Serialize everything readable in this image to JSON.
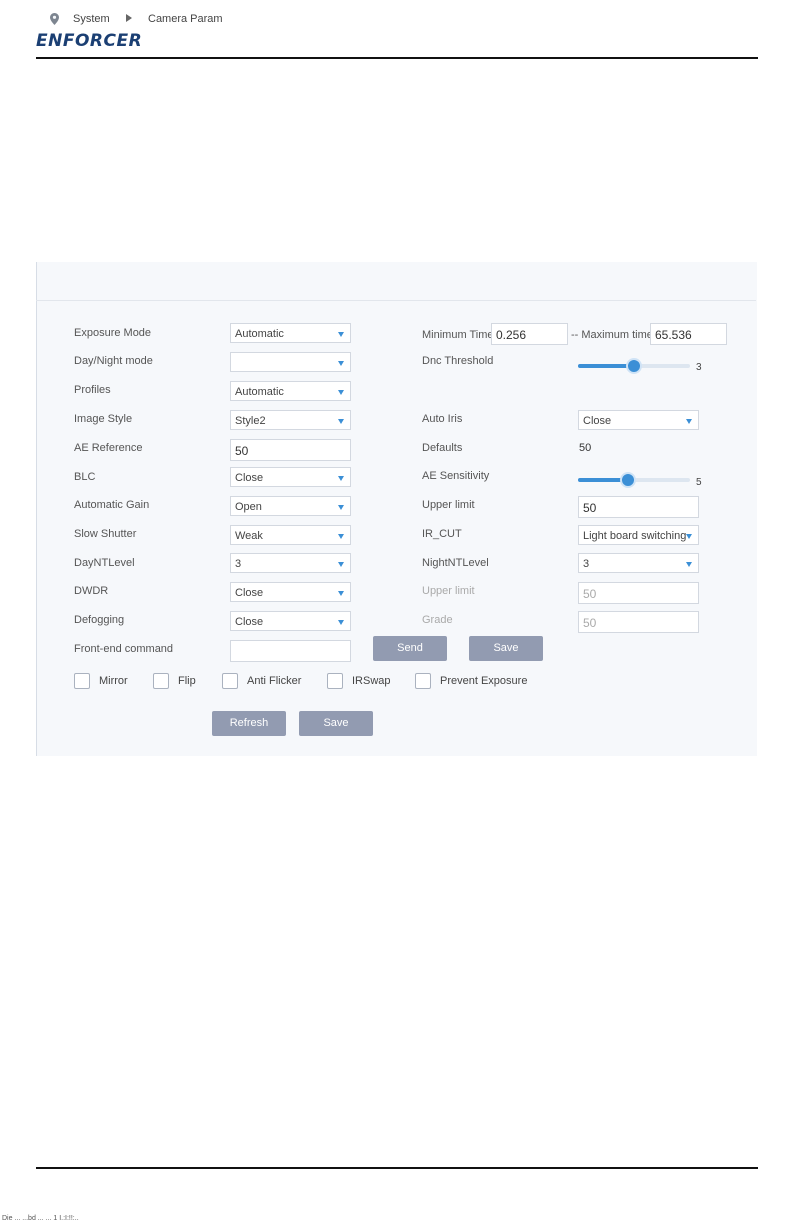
{
  "header": {
    "logo": "ENFORCER"
  },
  "footer": {
    "text": "Die ... ...bd ... ... 1 I.:I:!!:.."
  },
  "breadcrumb": {
    "items": [
      "System",
      "Camera Param"
    ]
  },
  "form": {
    "exposure_mode": {
      "label": "Exposure Mode",
      "value": "Automatic"
    },
    "day_night_mode": {
      "label": "Day/Night mode",
      "value": ""
    },
    "profiles": {
      "label": "Profiles",
      "value": "Automatic"
    },
    "image_style": {
      "label": "Image Style",
      "value": "Style2"
    },
    "ae_reference": {
      "label": "AE Reference",
      "value": "50"
    },
    "blc": {
      "label": "BLC",
      "value": "Close"
    },
    "automatic_gain": {
      "label": "Automatic Gain",
      "value": "Open"
    },
    "slow_shutter": {
      "label": "Slow Shutter",
      "value": "Weak"
    },
    "day_nt_level": {
      "label": "DayNTLevel",
      "value": "3"
    },
    "dwdr": {
      "label": "DWDR",
      "value": "Close"
    },
    "defogging": {
      "label": "Defogging",
      "value": "Close"
    },
    "front_end_command": {
      "label": "Front-end command",
      "value": ""
    },
    "minimum_time": {
      "label": "Minimum Time",
      "value": "0.256"
    },
    "maximum_time": {
      "label": "-- Maximum time",
      "value": "65.536"
    },
    "dnc_threshold": {
      "label": "Dnc Threshold",
      "value": "3",
      "level": 0.5
    },
    "auto_iris": {
      "label": "Auto Iris",
      "value": "Close"
    },
    "defaults": {
      "label": "Defaults",
      "value": "50"
    },
    "ae_sensitivity": {
      "label": "AE Sensitivity",
      "value": "5",
      "level": 0.45
    },
    "upper_limit": {
      "label": "Upper limit",
      "value": "50"
    },
    "ir_cut": {
      "label": "IR_CUT",
      "value": "Light board switching"
    },
    "night_nt_level": {
      "label": "NightNTLevel",
      "value": "3"
    },
    "upper_limit2": {
      "label": "Upper limit",
      "value": "50"
    },
    "grade": {
      "label": "Grade",
      "value": "50"
    }
  },
  "buttons": {
    "send": "Send",
    "save_cmd": "Save",
    "refresh": "Refresh",
    "save": "Save"
  },
  "checkboxes": [
    "Mirror",
    "Flip",
    "Anti Flicker",
    "IRSwap",
    "Prevent Exposure"
  ],
  "colors": {
    "accent": "#3b8fd6",
    "button": "#929bb1",
    "panel": "#f6f8fb",
    "logo": "#1b3f73"
  }
}
